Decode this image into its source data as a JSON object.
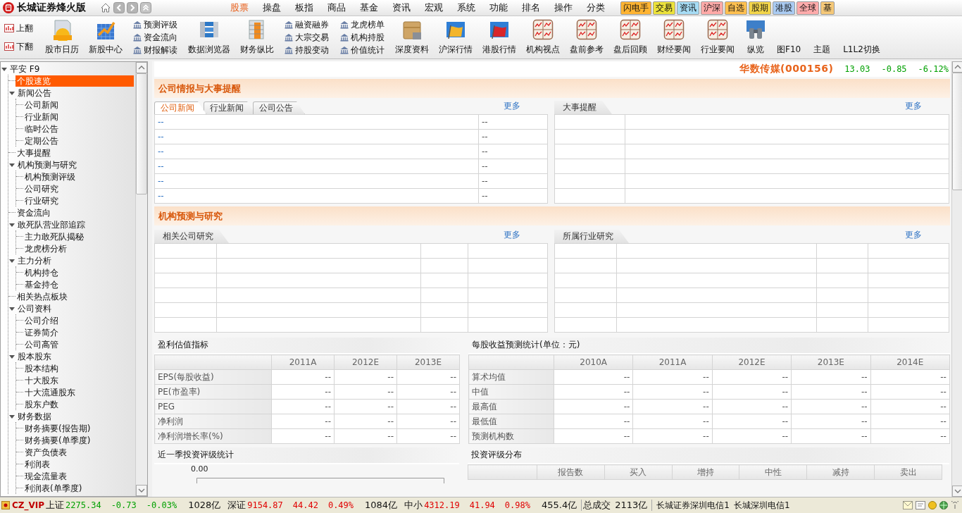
{
  "app": {
    "title": "长城证券烽火版"
  },
  "menu": [
    {
      "label": "股票",
      "selected": true
    },
    {
      "label": "操盘",
      "selected": false
    },
    {
      "label": "板指",
      "selected": false
    },
    {
      "label": "商品",
      "selected": false
    },
    {
      "label": "基金",
      "selected": false
    },
    {
      "label": "资讯",
      "selected": false
    },
    {
      "label": "宏观",
      "selected": false
    },
    {
      "label": "系统",
      "selected": false
    },
    {
      "label": "功能",
      "selected": false
    },
    {
      "label": "排名",
      "selected": false
    },
    {
      "label": "操作",
      "selected": false
    },
    {
      "label": "分类",
      "selected": false
    }
  ],
  "quick_tabs": [
    {
      "label": "闪电手",
      "color": "#ffb432"
    },
    {
      "label": "交易",
      "color": "#ece23c"
    },
    {
      "label": "资讯",
      "color": "#a6dcf5"
    },
    {
      "label": "沪深",
      "color": "#ffaaa8"
    },
    {
      "label": "自选",
      "color": "#ffc050"
    },
    {
      "label": "股期",
      "color": "#f2d54a"
    },
    {
      "label": "港股",
      "color": "#aacbf2"
    },
    {
      "label": "全球",
      "color": "#ffabab"
    },
    {
      "label": "基",
      "color": "#f5c878"
    }
  ],
  "toolbar": [
    {
      "kind": "pager",
      "items": [
        "上翻",
        "下翻"
      ]
    },
    {
      "kind": "calendar",
      "label": "股市日历"
    },
    {
      "kind": "growth",
      "label": "新股中心"
    },
    {
      "kind": "links",
      "items": [
        "预测评级",
        "资金流向",
        "财报解读"
      ]
    },
    {
      "kind": "browser",
      "label": "数据浏览器"
    },
    {
      "kind": "stack",
      "label": "财务纵比"
    },
    {
      "kind": "links",
      "items": [
        "融资融券",
        "大宗交易",
        "持股变动"
      ]
    },
    {
      "kind": "links",
      "items": [
        "龙虎榜单",
        "机构持股",
        "价值统计"
      ]
    },
    {
      "kind": "folder",
      "label": "深度资料"
    },
    {
      "kind": "flag-gold",
      "label": "沪深行情"
    },
    {
      "kind": "flag-red",
      "label": "港股行情"
    },
    {
      "kind": "chart",
      "label": "机构视点"
    },
    {
      "kind": "chart",
      "label": "盘前参考"
    },
    {
      "kind": "chart",
      "label": "盘后回顾"
    },
    {
      "kind": "chart",
      "label": "财经要闻"
    },
    {
      "kind": "chart",
      "label": "行业要闻"
    },
    {
      "kind": "binoculars",
      "label": "纵览"
    },
    {
      "kind": "plain",
      "label": "图F10"
    },
    {
      "kind": "plain",
      "label": "主题"
    },
    {
      "kind": "plain",
      "label": "L1L2切换"
    }
  ],
  "tree": {
    "label": "平安 F9",
    "expanded": true,
    "selected": false,
    "children": [
      {
        "label": "个股速览",
        "selected": true
      },
      {
        "label": "新闻公告",
        "expanded": true,
        "selected": false,
        "children": [
          {
            "label": "公司新闻",
            "selected": false
          },
          {
            "label": "行业新闻",
            "selected": false
          },
          {
            "label": "临时公告",
            "selected": false
          },
          {
            "label": "定期公告",
            "selected": false
          }
        ]
      },
      {
        "label": "大事提醒",
        "selected": false
      },
      {
        "label": "机构预测与研究",
        "expanded": true,
        "selected": false,
        "children": [
          {
            "label": "机构预测评级",
            "selected": false
          },
          {
            "label": "公司研究",
            "selected": false
          },
          {
            "label": "行业研究",
            "selected": false
          }
        ]
      },
      {
        "label": "资金流向",
        "selected": false
      },
      {
        "label": "敢死队营业部追踪",
        "expanded": true,
        "selected": false,
        "children": [
          {
            "label": "主力敢死队揭秘",
            "selected": false
          },
          {
            "label": "龙虎榜分析",
            "selected": false
          }
        ]
      },
      {
        "label": "主力分析",
        "expanded": true,
        "selected": false,
        "children": [
          {
            "label": "机构持仓",
            "selected": false
          },
          {
            "label": "基金持仓",
            "selected": false
          }
        ]
      },
      {
        "label": "相关热点板块",
        "selected": false
      },
      {
        "label": "公司资料",
        "expanded": true,
        "selected": false,
        "children": [
          {
            "label": "公司介绍",
            "selected": false
          },
          {
            "label": "证券简介",
            "selected": false
          },
          {
            "label": "公司高管",
            "selected": false
          }
        ]
      },
      {
        "label": "股本股东",
        "expanded": true,
        "selected": false,
        "children": [
          {
            "label": "股本结构",
            "selected": false
          },
          {
            "label": "十大股东",
            "selected": false
          },
          {
            "label": "十大流通股东",
            "selected": false
          },
          {
            "label": "股东户数",
            "selected": false
          }
        ]
      },
      {
        "label": "财务数据",
        "expanded": true,
        "selected": false,
        "children": [
          {
            "label": "财务摘要(报告期)",
            "selected": false
          },
          {
            "label": "财务摘要(单季度)",
            "selected": false
          },
          {
            "label": "资产负债表",
            "selected": false
          },
          {
            "label": "利润表",
            "selected": false
          },
          {
            "label": "现金流量表",
            "selected": false
          },
          {
            "label": "利润表(单季度)",
            "selected": false
          }
        ]
      }
    ]
  },
  "stock": {
    "name": "华数传媒(000156)",
    "price": "13.03",
    "change": "-0.85",
    "change_pct": "-6.12%",
    "color": "#00a000"
  },
  "intel": {
    "title": "公司情报与大事提醒",
    "news": {
      "tabs": [
        {
          "label": "公司新闻",
          "selected": true
        },
        {
          "label": "行业新闻",
          "selected": false
        },
        {
          "label": "公司公告",
          "selected": false
        }
      ],
      "more": "更多",
      "rows": [
        [
          "--",
          "--"
        ],
        [
          "--",
          "--"
        ],
        [
          "--",
          "--"
        ],
        [
          "--",
          "--"
        ],
        [
          "--",
          "--"
        ],
        [
          "--",
          "--"
        ]
      ]
    },
    "events": {
      "tab": "大事提醒",
      "more": "更多"
    }
  },
  "research": {
    "title": "机构预测与研究",
    "company": {
      "tab": "相关公司研究",
      "more": "更多"
    },
    "industry": {
      "tab": "所属行业研究",
      "more": "更多"
    }
  },
  "valuation": {
    "title": "盈利估值指标",
    "columns": [
      "2011A",
      "2012E",
      "2013E"
    ],
    "rows": [
      {
        "label": "EPS(每股收益)",
        "values": [
          "--",
          "--",
          "--"
        ]
      },
      {
        "label": "PE(市盈率)",
        "values": [
          "--",
          "--",
          "--"
        ]
      },
      {
        "label": "PEG",
        "values": [
          "--",
          "--",
          "--"
        ]
      },
      {
        "label": "净利润",
        "values": [
          "--",
          "--",
          "--"
        ]
      },
      {
        "label": "净利润增长率(%)",
        "values": [
          "--",
          "--",
          "--"
        ]
      }
    ]
  },
  "eps_forecast": {
    "title": "每股收益预测统计(单位：元)",
    "columns": [
      "2010A",
      "2011A",
      "2012E",
      "2013E",
      "2014E"
    ],
    "rows": [
      {
        "label": "算术均值",
        "values": [
          "--",
          "--",
          "--",
          "--",
          "--"
        ]
      },
      {
        "label": "中值",
        "values": [
          "--",
          "--",
          "--",
          "--",
          "--"
        ]
      },
      {
        "label": "最高值",
        "values": [
          "--",
          "--",
          "--",
          "--",
          "--"
        ]
      },
      {
        "label": "最低值",
        "values": [
          "--",
          "--",
          "--",
          "--",
          "--"
        ]
      },
      {
        "label": "预测机构数",
        "values": [
          "--",
          "--",
          "--",
          "--",
          "--"
        ]
      }
    ]
  },
  "rating_stats": {
    "title": "近一季投资评级统计",
    "axis_label": "0.00"
  },
  "rating_distribution": {
    "title": "投资评级分布",
    "columns": [
      "报告数",
      "买入",
      "增持",
      "中性",
      "减持",
      "卖出"
    ]
  },
  "status_bar": {
    "user": "CZ_VIP",
    "indices": [
      {
        "name": "上证",
        "value": "2275.34",
        "change": "-0.73",
        "pct": "-0.03%",
        "volume": "1028亿",
        "color": "#00a000"
      },
      {
        "name": "深证",
        "value": "9154.87",
        "change": "44.42",
        "pct": "0.49%",
        "volume": "1084亿",
        "color": "#e00000"
      },
      {
        "name": "中小",
        "value": "4312.19",
        "change": "41.94",
        "pct": "0.98%",
        "volume": "455.4亿",
        "color": "#e00000"
      }
    ],
    "total": {
      "label": "总成交",
      "value": "2113亿"
    },
    "servers": [
      "长城证券深圳电信1",
      "长城深圳电信1"
    ]
  }
}
